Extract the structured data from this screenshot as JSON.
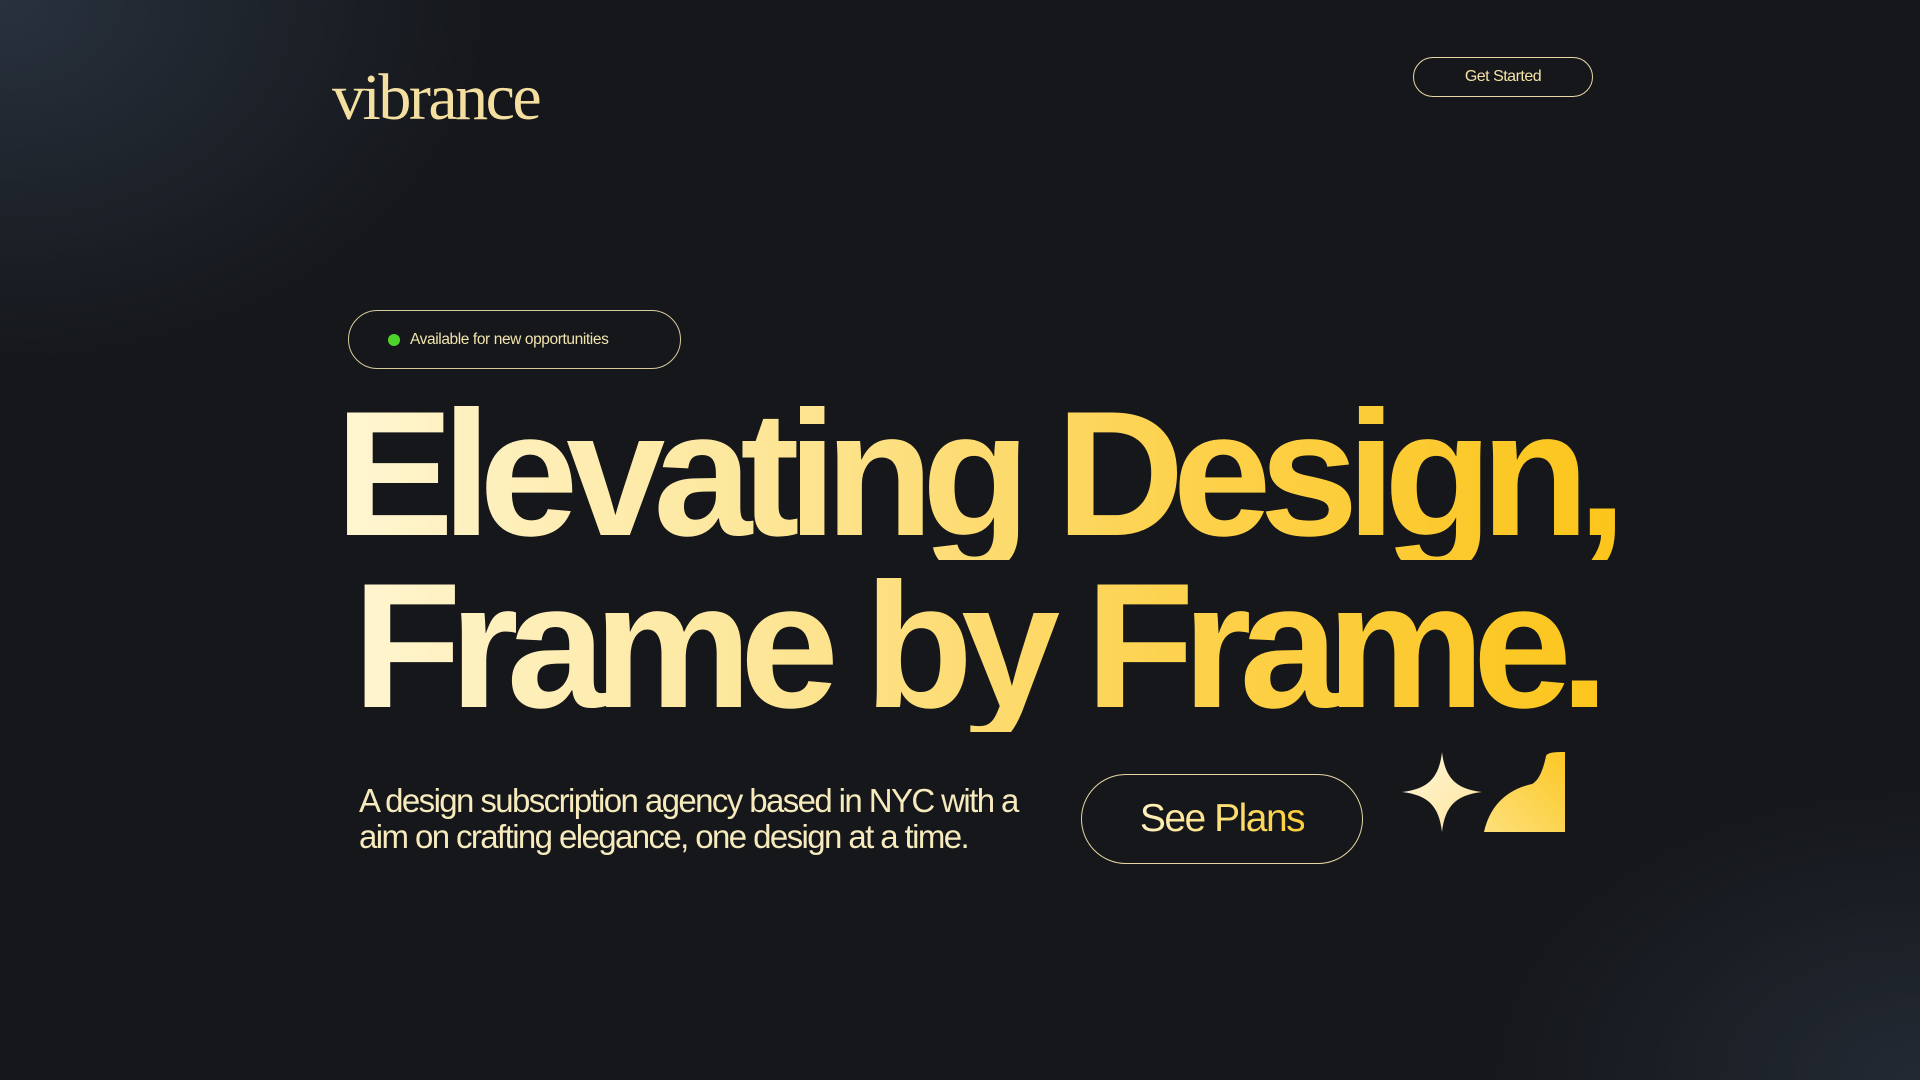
{
  "header": {
    "logo_text": "vibrance",
    "cta_label": "Get Started"
  },
  "badge": {
    "status_color": "#4fd42b",
    "text": "Available for new opportunities"
  },
  "hero": {
    "headline_line1": "Elevating Design,",
    "headline_line2": "Frame by Frame.",
    "subtitle": "A design subscription agency based in NYC with a aim on crafting elegance, one design at a time.",
    "cta_label": "See Plans"
  },
  "decor": {
    "icons": [
      "sparkle-icon",
      "quarter-curve-icon"
    ]
  },
  "colors": {
    "background": "#15171b",
    "accent_light": "#fff6d2",
    "accent_gold": "#fcc51a"
  }
}
